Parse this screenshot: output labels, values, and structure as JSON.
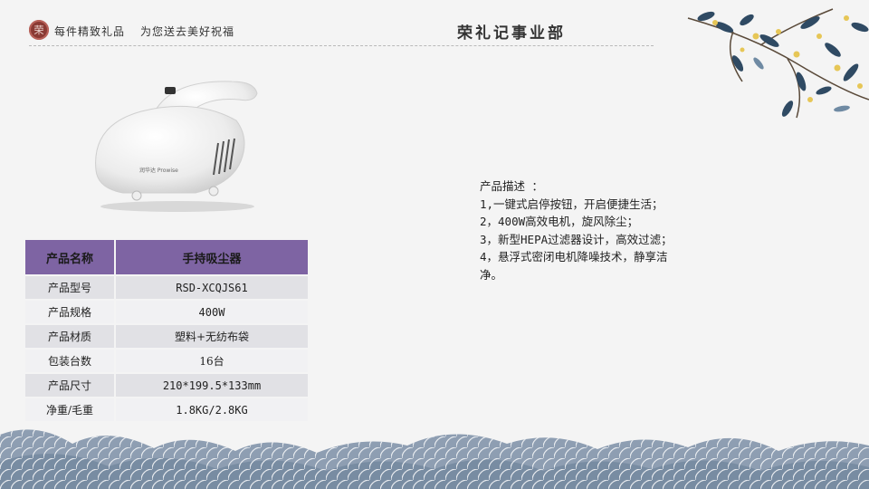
{
  "header": {
    "logo_text": "荣",
    "slogan_1": "每件精致礼品",
    "slogan_2": "为您送去美好祝福",
    "dept_title": "荣礼记事业部"
  },
  "product_image": {
    "brand_text": "润华达 Prowise"
  },
  "spec_table": {
    "header": {
      "label": "产品名称",
      "value": "手持吸尘器"
    },
    "rows": [
      {
        "label": "产品型号",
        "value": "RSD-XCQJS61"
      },
      {
        "label": "产品规格",
        "value": "400W"
      },
      {
        "label": "产品材质",
        "value": "塑料+无纺布袋"
      },
      {
        "label": "包装台数",
        "value": "16台"
      },
      {
        "label": "产品尺寸",
        "value": "210*199.5*133mm"
      },
      {
        "label": "净重/毛重",
        "value": "1.8KG/2.8KG"
      }
    ]
  },
  "description": {
    "title": "产品描述 ：",
    "lines": [
      "1,一键式启停按钮，开启便捷生活；",
      "2，400W高效电机，旋风除尘；",
      "3，新型HEPA过滤器设计，高效过滤；",
      "4，悬浮式密闭电机降噪技术，静享洁",
      "净。"
    ]
  },
  "colors": {
    "table_header": "#7e64a3",
    "row_odd": "#e1e1e5",
    "row_even": "#f1f1f3",
    "leaf": "#2f4a63",
    "blossom": "#e6c656"
  }
}
